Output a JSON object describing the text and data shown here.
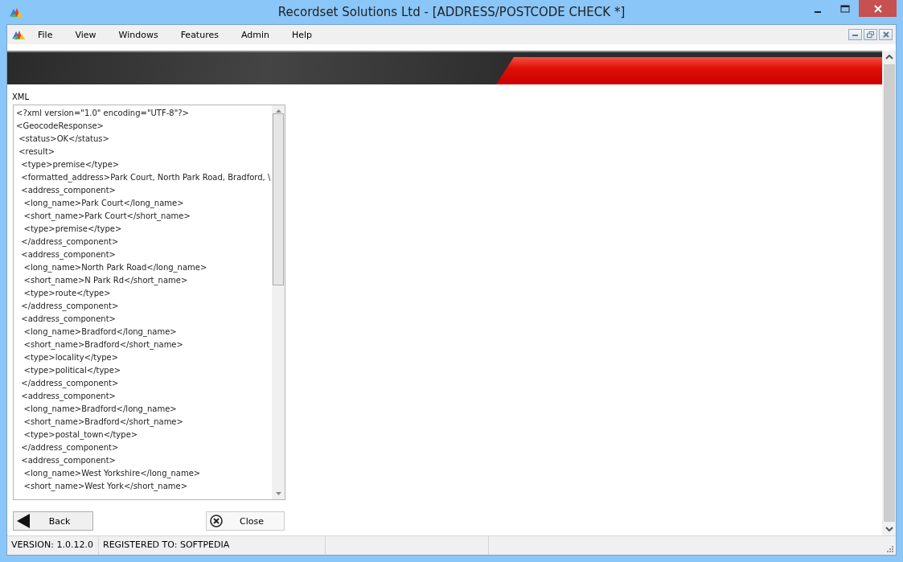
{
  "window": {
    "title": "Recordset Solutions Ltd - [ADDRESS/POSTCODE CHECK *]"
  },
  "menu": [
    "File",
    "View",
    "Windows",
    "Features",
    "Admin",
    "Help"
  ],
  "xml_panel": {
    "label": "XML",
    "lines": [
      "<?xml version=\"1.0\" encoding=\"UTF-8\"?>",
      "<GeocodeResponse>",
      " <status>OK</status>",
      " <result>",
      "  <type>premise</type>",
      "  <formatted_address>Park Court, North Park Road, Bradford, \\",
      "  <address_component>",
      "   <long_name>Park Court</long_name>",
      "   <short_name>Park Court</short_name>",
      "   <type>premise</type>",
      "  </address_component>",
      "  <address_component>",
      "   <long_name>North Park Road</long_name>",
      "   <short_name>N Park Rd</short_name>",
      "   <type>route</type>",
      "  </address_component>",
      "  <address_component>",
      "   <long_name>Bradford</long_name>",
      "   <short_name>Bradford</short_name>",
      "   <type>locality</type>",
      "   <type>political</type>",
      "  </address_component>",
      "  <address_component>",
      "   <long_name>Bradford</long_name>",
      "   <short_name>Bradford</short_name>",
      "   <type>postal_town</type>",
      "  </address_component>",
      "  <address_component>",
      "   <long_name>West Yorkshire</long_name>",
      "   <short_name>West York</short_name>"
    ]
  },
  "buttons": [
    {
      "kind": "back",
      "label": "Back"
    },
    {
      "kind": "close",
      "label": "Close"
    }
  ],
  "status_bar": [
    "VERSION: 1.0.12.0",
    "REGISTERED TO: SOFTPEDIA"
  ]
}
